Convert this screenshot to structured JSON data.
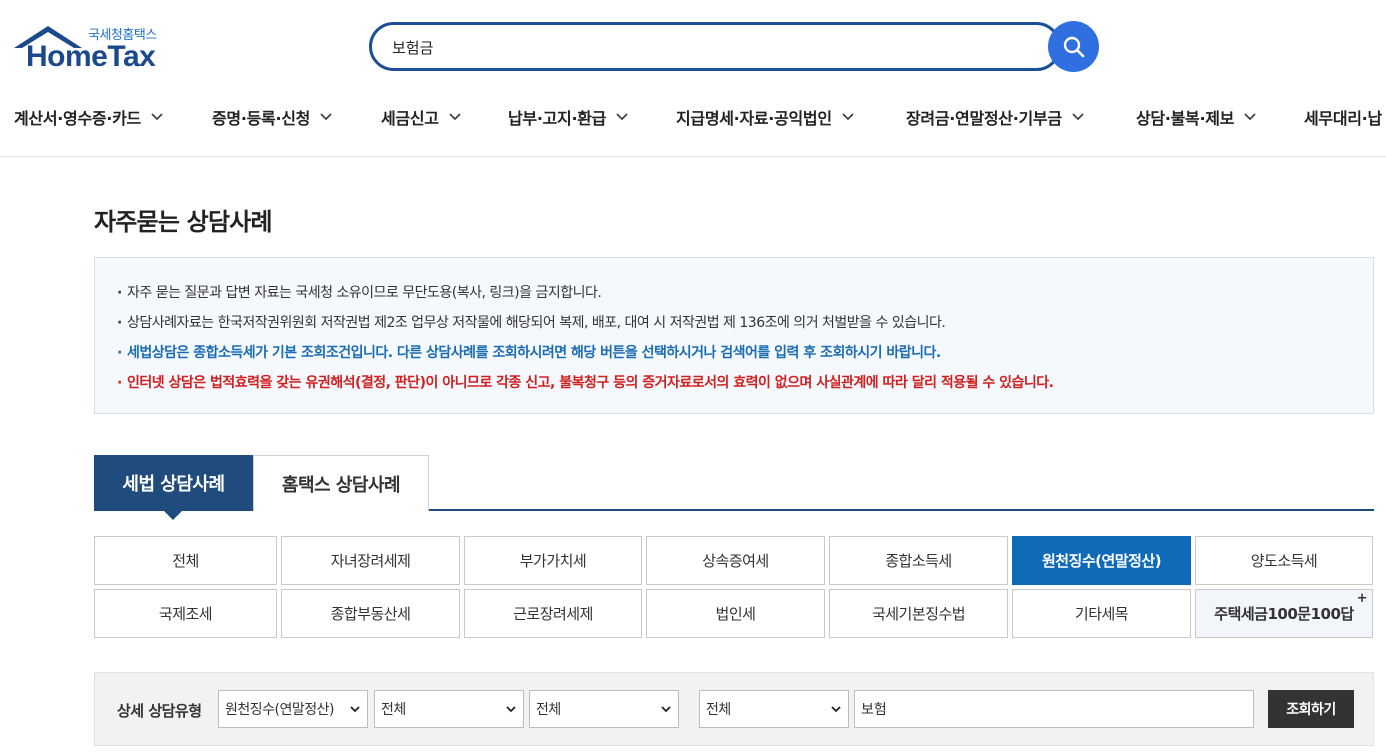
{
  "header": {
    "logo_sub": "국세청홈택스",
    "logo_main": "HomeTax",
    "search_value": "보험금"
  },
  "gnb": [
    {
      "label": "계산서·영수증·카드"
    },
    {
      "label": "증명·등록·신청"
    },
    {
      "label": "세금신고"
    },
    {
      "label": "납부·고지·환급"
    },
    {
      "label": "지급명세·자료·공익법인"
    },
    {
      "label": "장려금·연말정산·기부금"
    },
    {
      "label": "상담·불복·제보"
    },
    {
      "label": "세무대리·납"
    }
  ],
  "page_title": "자주묻는 상담사례",
  "notice": [
    "자주 묻는 질문과 답변 자료는 국세청 소유이므로 무단도용(복사, 링크)을 금지합니다.",
    "상담사례자료는 한국저작권위원회 저작권법 제2조 업무상 저작물에 해당되어 복제, 배포, 대여 시 저작권법 제 136조에 의거 처벌받을 수 있습니다.",
    "세법상담은 종합소득세가 기본 조회조건입니다. 다른 상담사례를 조회하시려면 해당 버튼을 선택하시거나 검색어를 입력 후 조회하시기 바랍니다.",
    "인터넷 상담은 법적효력을 갖는 유권해석(결정, 판단)이 아니므로 각종 신고, 불복청구 등의 증거자료로서의 효력이 없으며 사실관계에 따라 달리 적용될 수 있습니다."
  ],
  "tabs": {
    "active": "세법 상담사례",
    "inactive": "홈택스 상담사례"
  },
  "categories": {
    "row1": [
      "전체",
      "자녀장려세제",
      "부가가치세",
      "상속증여세",
      "종합소득세",
      "원천징수(연말정산)",
      "양도소득세"
    ],
    "row2": [
      "국제조세",
      "종합부동산세",
      "근로장려세제",
      "법인세",
      "국세기본징수법",
      "기타세목",
      "주택세금100문100답"
    ],
    "special_mark": "+",
    "active_color": "#0f6bb7"
  },
  "filter": {
    "label": "상세 상담유형",
    "select1": "원천징수(연말정산)",
    "select2": "전체",
    "select3": "전체",
    "select4": "전체",
    "keyword": "보험",
    "submit": "조회하기"
  },
  "colors": {
    "brand": "#1b4a8c",
    "search_button": "#2f6fe0",
    "tab_active": "#1f4b7d",
    "notice_blue": "#1a6cb3",
    "notice_red": "#d11e1e"
  }
}
